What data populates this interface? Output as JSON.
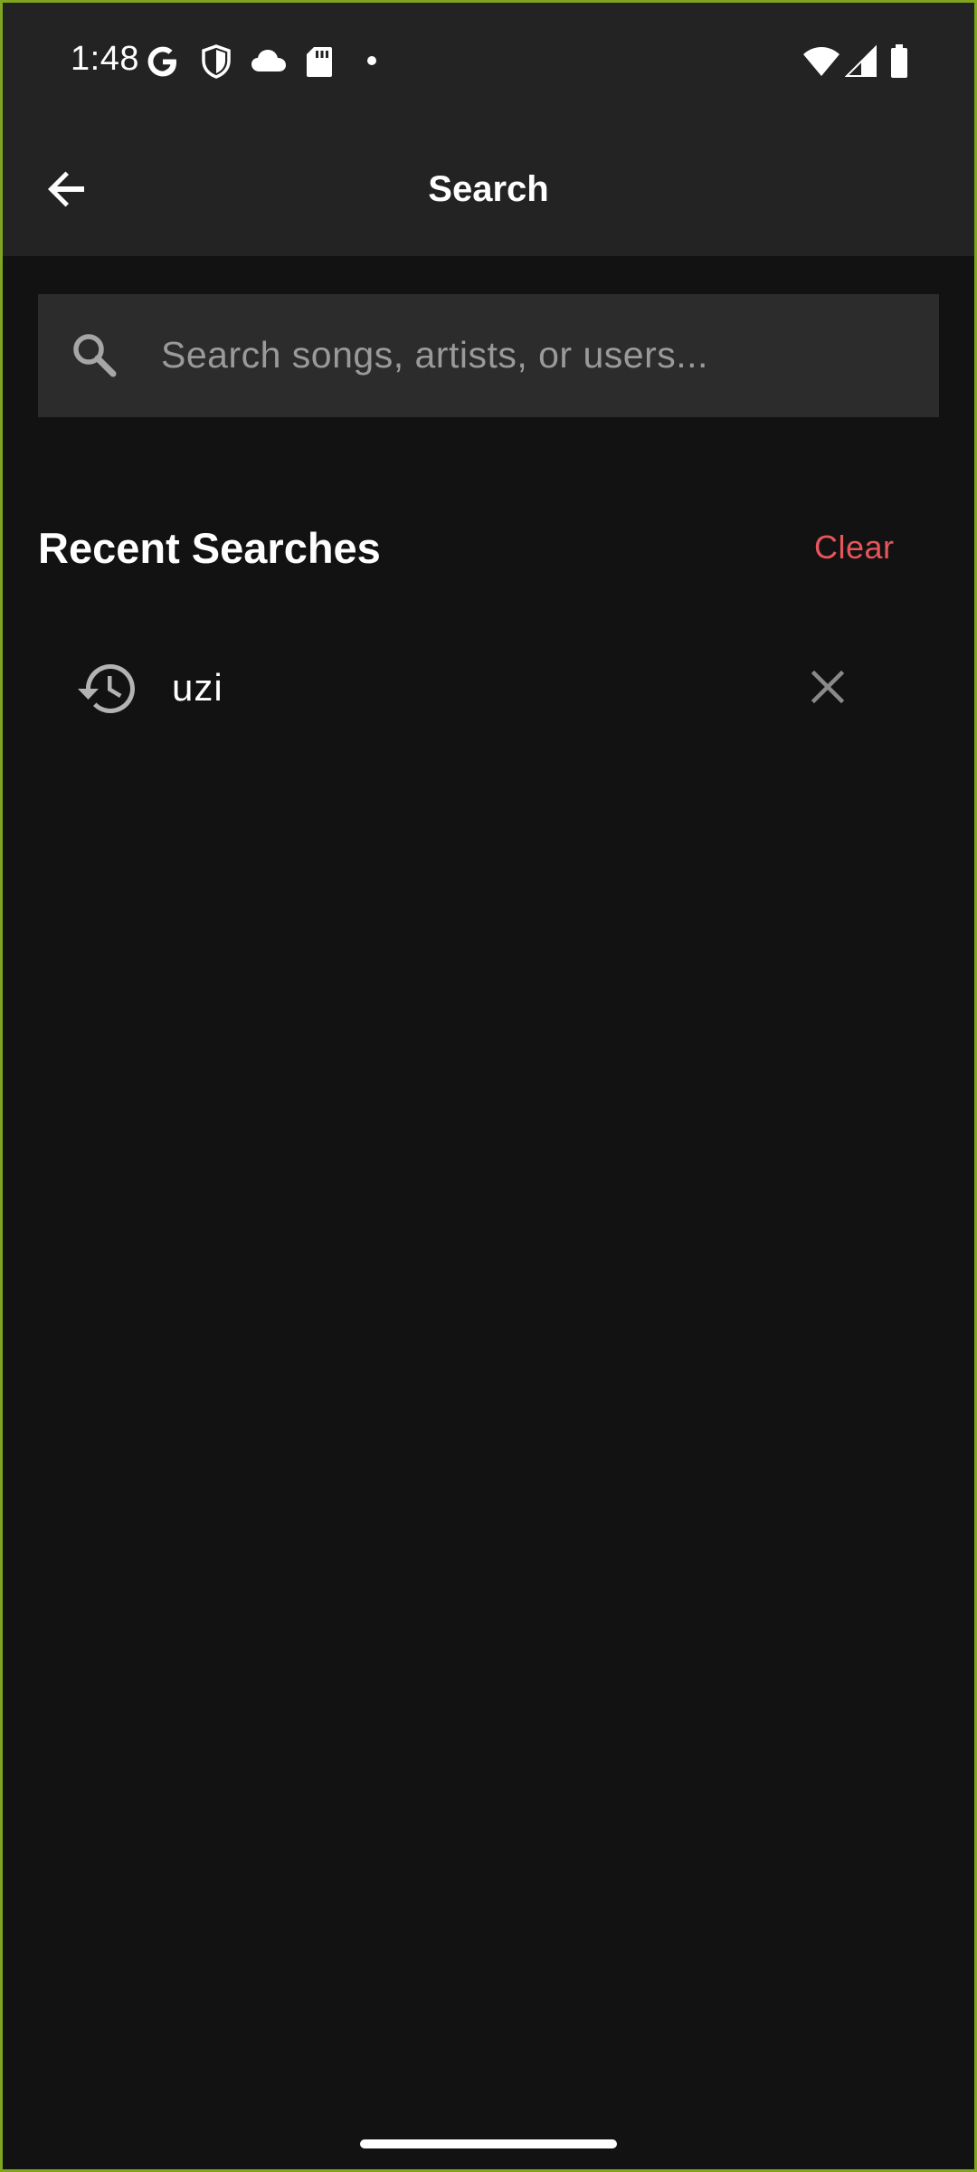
{
  "status_bar": {
    "time": "1:48",
    "left_icons": [
      "google-icon",
      "shield-icon",
      "cloud-icon",
      "sd-card-icon",
      "dot-icon"
    ],
    "right_icons": [
      "wifi-icon",
      "cellular-signal-icon",
      "battery-icon"
    ]
  },
  "app_bar": {
    "title": "Search",
    "back_icon": "arrow-back-icon"
  },
  "search": {
    "placeholder": "Search songs, artists, or users...",
    "value": ""
  },
  "recent": {
    "title": "Recent Searches",
    "clear_label": "Clear",
    "items": [
      {
        "label": "uzi"
      }
    ]
  },
  "colors": {
    "background": "#121212",
    "app_bar": "#232323",
    "search_field": "#2c2c2c",
    "accent": "#E8555A",
    "frame": "#7FA61E"
  }
}
